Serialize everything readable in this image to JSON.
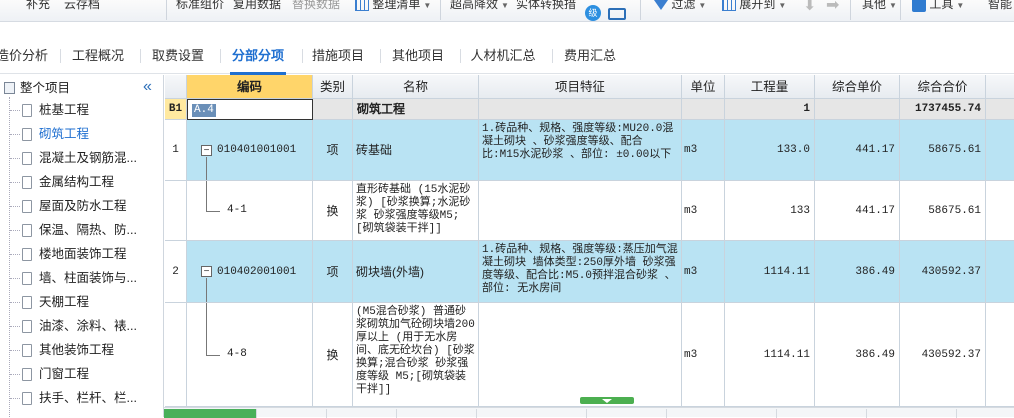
{
  "toolbar": {
    "items": {
      "supplement": "补充",
      "cloud_save": "云存档",
      "standard_group": "标准组价",
      "copy_data": "复用数据",
      "replace_data": "替换数据",
      "organize_list": "整理清单",
      "super_reduce": "超高降效",
      "entity_conversion": "实体转换措",
      "filter": "过滤",
      "expand_to": "展开到",
      "other": "其他",
      "tools": "工具",
      "smart": "智能"
    },
    "icons": {
      "circle_text": "级"
    }
  },
  "tabs": [
    {
      "label": "造价分析"
    },
    {
      "label": "工程概况"
    },
    {
      "label": "取费设置"
    },
    {
      "label": "分部分项",
      "active": true
    },
    {
      "label": "措施项目"
    },
    {
      "label": "其他项目"
    },
    {
      "label": "人材机汇总"
    },
    {
      "label": "费用汇总"
    }
  ],
  "sidebar": {
    "root": "整个项目",
    "items": [
      {
        "label": "桩基工程"
      },
      {
        "label": "砌筑工程",
        "selected": true
      },
      {
        "label": "混凝土及钢筋混..."
      },
      {
        "label": "金属结构工程"
      },
      {
        "label": "屋面及防水工程"
      },
      {
        "label": "保温、隔热、防..."
      },
      {
        "label": "楼地面装饰工程"
      },
      {
        "label": "墙、柱面装饰与..."
      },
      {
        "label": "天棚工程"
      },
      {
        "label": "油漆、涂料、裱..."
      },
      {
        "label": "其他装饰工程"
      },
      {
        "label": "门窗工程"
      },
      {
        "label": "扶手、栏杆、栏..."
      }
    ]
  },
  "grid": {
    "headers": {
      "code": "编码",
      "category": "类别",
      "name": "名称",
      "feature": "项目特征",
      "unit": "单位",
      "quantity": "工程量",
      "unit_price": "综合单价",
      "total_price": "综合合价"
    },
    "division": {
      "row_label": "B1",
      "code": "A.4",
      "name": "砌筑工程",
      "quantity": "1",
      "total_price": "1737455.74"
    },
    "rows": [
      {
        "row_no": "1",
        "code": "010401001001",
        "category": "项",
        "name": "砖基础",
        "feature": "1.砖品种、规格、强度等级:MU20.0混凝土砌块 、砂浆强度等级、配合比:M15水泥砂浆 、部位: ±0.00以下",
        "unit": "m3",
        "quantity": "133.0",
        "unit_price": "441.17",
        "total_price": "58675.61"
      },
      {
        "row_no": "",
        "code": "4-1",
        "category": "换",
        "name": "直形砖基础 (15水泥砂浆) [砂浆换算;水泥砂浆 砂浆强度等级M5;[砌筑袋装干拌]]",
        "feature": "",
        "unit": "m3",
        "quantity": "133",
        "unit_price": "441.17",
        "total_price": "58675.61"
      },
      {
        "row_no": "2",
        "code": "010402001001",
        "category": "项",
        "name": "砌块墙(外墙)",
        "feature": "1.砖品种、规格、强度等级:蒸压加气混凝土砌块 墙体类型:250厚外墙 砂浆强度等级、配合比:M5.0预拌混合砂浆 、部位: 无水房间",
        "unit": "m3",
        "quantity": "1114.11",
        "unit_price": "386.49",
        "total_price": "430592.37"
      },
      {
        "row_no": "",
        "code": "4-8",
        "category": "换",
        "name": "(M5混合砂浆) 普通砂浆砌筑加气砼砌块墙200厚以上 (用于无水房间、底无砼坎台) [砂浆换算;混合砂浆 砂浆强度等级 M5;[砌筑袋装干拌]]",
        "feature": "",
        "unit": "m3",
        "quantity": "1114.11",
        "unit_price": "386.49",
        "total_price": "430592.37"
      }
    ]
  }
}
